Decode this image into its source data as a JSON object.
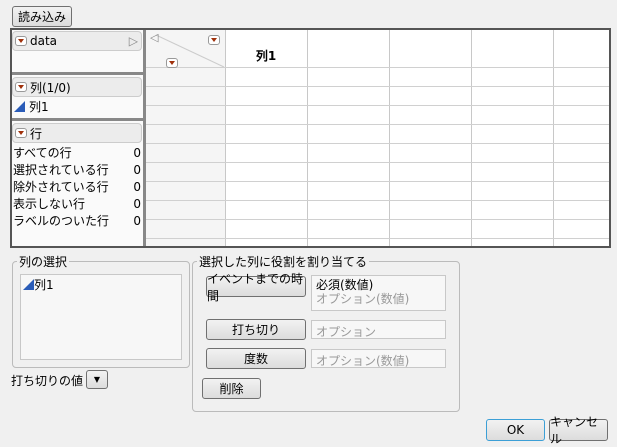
{
  "toolbar": {
    "load_button": "読み込み"
  },
  "table_panel": {
    "name": "data",
    "columns_header": "列(1/0)",
    "columns": [
      {
        "name": "列1"
      }
    ],
    "rows_header": "行",
    "row_stats": [
      {
        "label": "すべての行",
        "value": "0"
      },
      {
        "label": "選択されている行",
        "value": "0"
      },
      {
        "label": "除外されている行",
        "value": "0"
      },
      {
        "label": "表示しない行",
        "value": "0"
      },
      {
        "label": "ラベルのついた行",
        "value": "0"
      }
    ]
  },
  "grid": {
    "column_header": "列1"
  },
  "column_select": {
    "title": "列の選択",
    "items": [
      "列1"
    ]
  },
  "censor_value": {
    "label": "打ち切りの値"
  },
  "roles": {
    "title": "選択した列に役割を割り当てる",
    "time_button": "イベントまでの時間",
    "time_required": "必須(数値)",
    "time_optional": "オプション(数値)",
    "censor_button": "打ち切り",
    "censor_placeholder": "オプション",
    "freq_button": "度数",
    "freq_placeholder": "オプション(数値)",
    "remove_button": "削除"
  },
  "actions": {
    "ok": "OK",
    "cancel": "キャンセル"
  }
}
